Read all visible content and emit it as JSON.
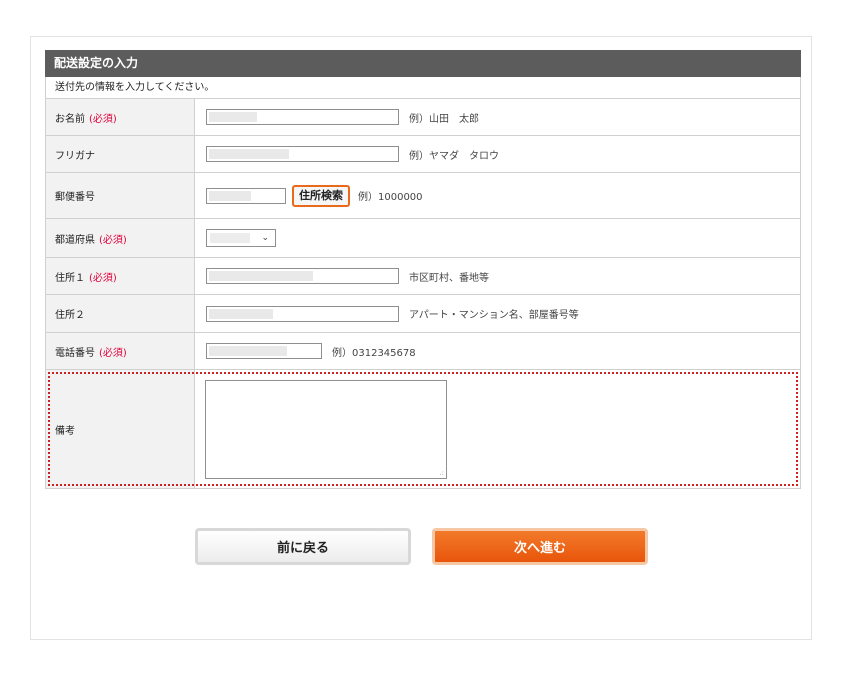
{
  "form": {
    "title": "配送設定の入力",
    "intro": "送付先の情報を入力してください。",
    "required_mark": "(必須)",
    "fields": {
      "name": {
        "label": "お名前",
        "hint": "例）山田　太郎"
      },
      "furigana": {
        "label": "フリガナ",
        "hint": "例）ヤマダ　タロウ"
      },
      "zip": {
        "label": "郵便番号",
        "button": "住所検索",
        "hint": "例）1000000"
      },
      "prefecture": {
        "label": "都道府県"
      },
      "address1": {
        "label": "住所１",
        "hint": "市区町村、番地等"
      },
      "address2": {
        "label": "住所２",
        "hint": "アパート・マンション名、部屋番号等"
      },
      "phone": {
        "label": "電話番号",
        "hint": "例）0312345678"
      },
      "remarks": {
        "label": "備考"
      }
    }
  },
  "buttons": {
    "back": "前に戻る",
    "next": "次へ進む"
  },
  "colors": {
    "header_bg": "#5c5c5c",
    "required": "#e0003a",
    "accent": "#e8550b",
    "highlight_border": "#cc2222"
  }
}
